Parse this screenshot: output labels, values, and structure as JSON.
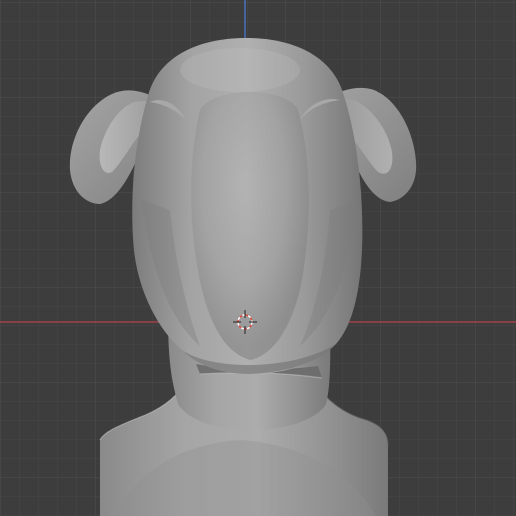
{
  "viewport": {
    "mode": "3d-viewport-front-orthographic",
    "colors": {
      "background": "#3d3d3d",
      "grid_minor": "#454545",
      "grid_major": "#4f4f4f",
      "axis_x": "#c0444f",
      "axis_z": "#4a7bd6",
      "mesh_base": "#9b9b9b",
      "cursor_red": "#e34a3a",
      "cursor_white": "#ffffff"
    },
    "objects": [
      {
        "name": "sculpt-head-mesh",
        "shading": "solid-matcap-grey"
      }
    ],
    "cursor": {
      "name": "3d-cursor"
    }
  }
}
